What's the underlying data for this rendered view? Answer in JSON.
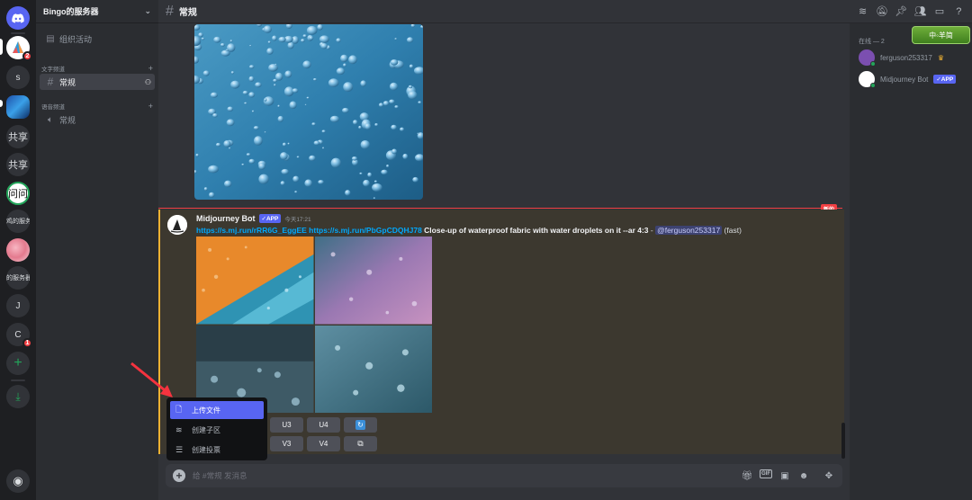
{
  "server_rail": {
    "items": [
      {
        "name": "discord-home",
        "label": ""
      },
      {
        "name": "server-current",
        "label": "",
        "badge": "2"
      },
      {
        "name": "server-s",
        "label": "s"
      },
      {
        "name": "server-image",
        "label": ""
      },
      {
        "name": "server-gongxiang-1",
        "label": "共享"
      },
      {
        "name": "server-gongxiang-2",
        "label": "共享"
      },
      {
        "name": "server-wenwen",
        "label": "问问"
      },
      {
        "name": "server-ji",
        "label": "鸡的服务"
      },
      {
        "name": "server-flower",
        "label": ""
      },
      {
        "name": "server-de",
        "label": "的服务器"
      },
      {
        "name": "server-j",
        "label": "J"
      },
      {
        "name": "server-c",
        "label": "C",
        "badge": "1"
      }
    ]
  },
  "sidebar": {
    "guild_name": "Bingo的服务器",
    "events_label": "组织活动",
    "text_category": "文字频道",
    "voice_category": "语音频道",
    "text_channel": "常规",
    "voice_channel": "常规"
  },
  "header": {
    "channel_title": "常规"
  },
  "message": {
    "author": "Midjourney Bot",
    "app_badge": "✓APP",
    "timestamp": "今天17:21",
    "link1": "https://s.mj.run/rRR6G_EggEE",
    "link2": "https://s.mj.run/PbGpCDQHJ78",
    "prompt": "Close-up of waterproof fabric with water droplets on it --ar 4:3",
    "separator": " - ",
    "mention": "@ferguson253317",
    "speed": "(fast)",
    "new_label": "新的",
    "upscale_buttons": [
      "U3",
      "U4"
    ],
    "variation_buttons": [
      "V3",
      "V4"
    ]
  },
  "popup_menu": {
    "items": [
      {
        "label": "上传文件",
        "icon": "upload-file-icon"
      },
      {
        "label": "创建子区",
        "icon": "thread-icon"
      },
      {
        "label": "创建投票",
        "icon": "poll-icon"
      }
    ]
  },
  "composer": {
    "placeholder": "给 #常规 发消息"
  },
  "members": {
    "header": "在线 — 2",
    "list": [
      {
        "name": "ferguson253317",
        "crown": "♛"
      },
      {
        "name": "Midjourney Bot",
        "badge": "✓APP"
      }
    ]
  },
  "sticker_text": "中◦羊简",
  "colors": {
    "accent": "#5865f2",
    "mention_highlight": "#f0b232",
    "new_line": "#f23f43",
    "link": "#00a8fc"
  }
}
